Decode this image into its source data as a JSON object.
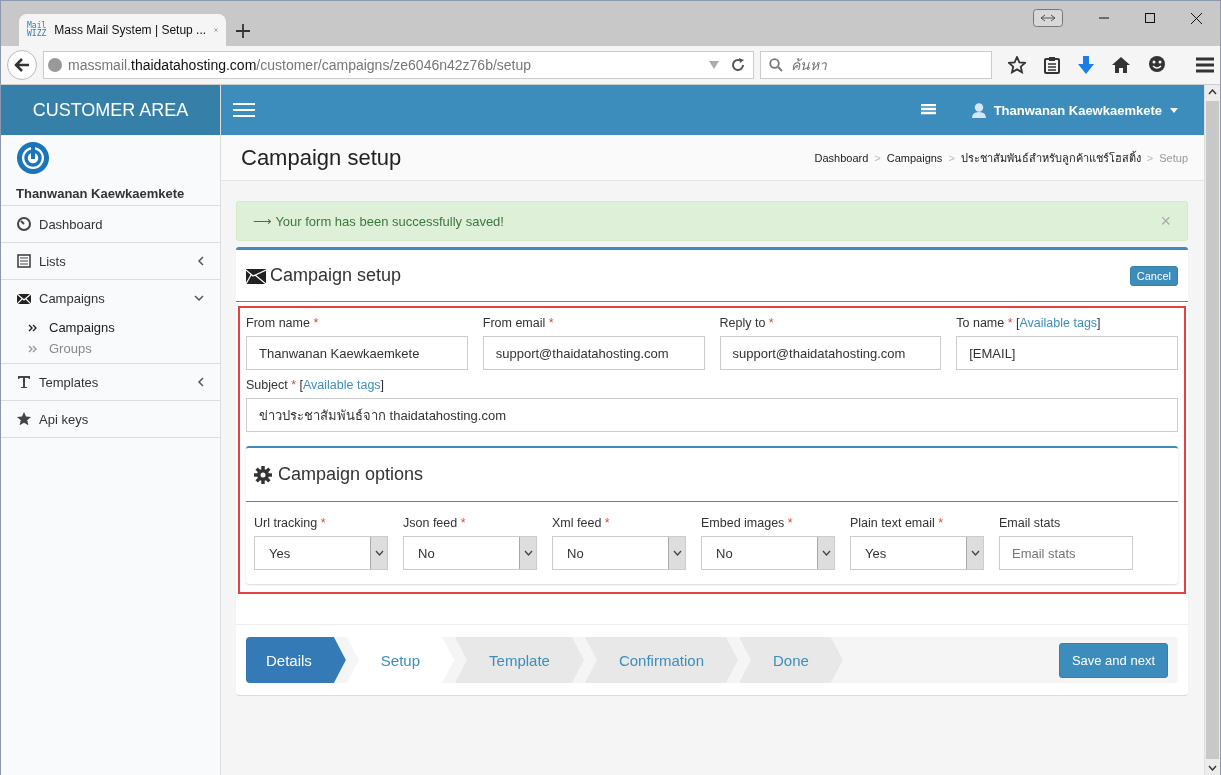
{
  "browser": {
    "tab": {
      "favicon_text": [
        "Mail",
        "WIZZ"
      ],
      "title": "Mass Mail System | Setup ...",
      "selected": true
    },
    "url": {
      "prefix": "massmail.",
      "domain": "thaidatahosting.com",
      "path": "/customer/campaigns/ze6046n42z76b/setup"
    },
    "search": {
      "placeholder": "ค้นหา"
    }
  },
  "header": {
    "brand": "CUSTOMER AREA",
    "user": "Thanwanan Kaewkaemkete"
  },
  "sidebar": {
    "user": "Thanwanan Kaewkaemkete",
    "items": [
      {
        "label": "Dashboard"
      },
      {
        "label": "Lists",
        "expanded": false
      },
      {
        "label": "Campaigns",
        "expanded": true,
        "children": [
          {
            "label": "Campaigns",
            "selected": true
          },
          {
            "label": "Groups",
            "selected": false
          }
        ]
      },
      {
        "label": "Templates",
        "expanded": false
      },
      {
        "label": "Api keys"
      }
    ]
  },
  "page": {
    "title": "Campaign setup",
    "breadcrumb": [
      {
        "label": "Dashboard",
        "selected": false,
        "separator": ">"
      },
      {
        "label": "Campaigns",
        "selected": false,
        "separator": ">"
      },
      {
        "label": "ประชาสัมพันธ์สำหรับลูกค้าแชร์โฮสติ้ง",
        "selected": false,
        "separator": ">"
      },
      {
        "label": "Setup",
        "selected": true
      }
    ]
  },
  "alert": {
    "message": "⟶ Your form has been successfully saved!",
    "close": "×"
  },
  "box": {
    "title": "Campaign setup",
    "cancel": "Cancel",
    "fields": [
      {
        "label": "From name",
        "required_mark": "*",
        "value": "Thanwanan Kaewkaemkete"
      },
      {
        "label": "From email",
        "required_mark": "*",
        "value": "support@thaidatahosting.com"
      },
      {
        "label": "Reply to",
        "required_mark": "*",
        "value": "support@thaidatahosting.com"
      },
      {
        "label": "To name",
        "required_mark": "*",
        "tags": {
          "before": "[",
          "link": "Available tags",
          "after": "]"
        },
        "value": "[EMAIL]"
      }
    ],
    "subject": {
      "label": "Subject",
      "required_mark": "*",
      "tags": {
        "before": "[",
        "link": "Available tags",
        "after": "]"
      },
      "value": "ข่าวประชาสัมพันธ์จาก thaidatahosting.com"
    },
    "options": {
      "title": "Campaign options",
      "items": [
        {
          "kind": "select",
          "label": "Url tracking",
          "required_mark": "*",
          "value": "Yes"
        },
        {
          "kind": "select",
          "label": "Json feed",
          "required_mark": "*",
          "value": "No"
        },
        {
          "kind": "select",
          "label": "Xml feed",
          "required_mark": "*",
          "value": "No"
        },
        {
          "kind": "select",
          "label": "Embed images",
          "required_mark": "*",
          "value": "No"
        },
        {
          "kind": "select",
          "label": "Plain text email",
          "required_mark": "*",
          "value": "Yes"
        },
        {
          "kind": "input",
          "label": "Email stats",
          "placeholder": "Email stats"
        }
      ]
    }
  },
  "wizard": {
    "steps": [
      {
        "label": "Details",
        "completed": true,
        "selected": false
      },
      {
        "label": "Setup",
        "completed": false,
        "selected": true
      },
      {
        "label": "Template",
        "completed": false,
        "selected": false
      },
      {
        "label": "Confirmation",
        "completed": false,
        "selected": false
      },
      {
        "label": "Done",
        "completed": false,
        "selected": false
      }
    ],
    "next": "Save and next"
  }
}
